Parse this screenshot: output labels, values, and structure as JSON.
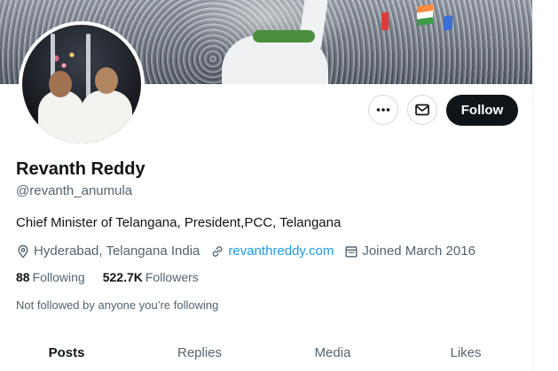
{
  "profile": {
    "name": "Revanth Reddy",
    "handle": "@revanth_anumula",
    "bio": "Chief Minister of Telangana, President,PCC, Telangana",
    "location": "Hyderabad, Telangana India",
    "website": "revanthreddy.com",
    "joined": "Joined March 2016",
    "following_count": "88",
    "following_label": "Following",
    "followers_count": "522.7K",
    "followers_label": "Followers",
    "followed_note": "Not followed by anyone you’re following"
  },
  "actions": {
    "more_icon": "more-icon",
    "message_icon": "message-icon",
    "follow_label": "Follow"
  },
  "tabs": [
    {
      "label": "Posts",
      "active": true
    },
    {
      "label": "Replies",
      "active": false
    },
    {
      "label": "Media",
      "active": false
    },
    {
      "label": "Likes",
      "active": false
    }
  ],
  "colors": {
    "link": "#1d9bf0",
    "text_primary": "#0f1419",
    "text_secondary": "#536471",
    "follow_button_bg": "#0f1419"
  }
}
